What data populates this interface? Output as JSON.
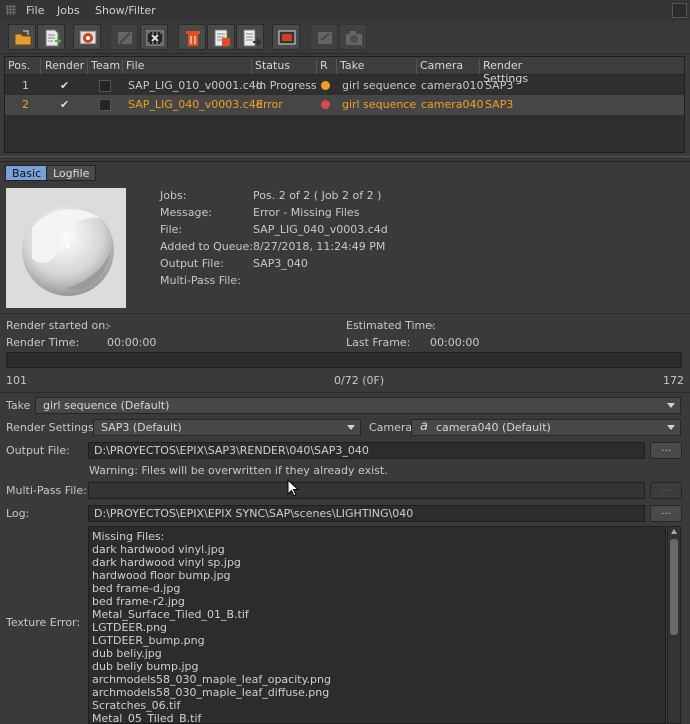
{
  "menu": {
    "file": "File",
    "jobs": "Jobs",
    "show_filter": "Show/Filter"
  },
  "table": {
    "headers": [
      "Pos.",
      "Render",
      "Team",
      "File",
      "Status",
      "R",
      "Take",
      "Camera",
      "Render Settings"
    ],
    "rows": [
      {
        "pos": "1",
        "file": "SAP_LIG_010_v0001.c4d",
        "status": "In Progress",
        "status_color": "#f0a020",
        "take": "girl sequence",
        "camera": "camera010",
        "render_settings": "SAP3"
      },
      {
        "pos": "2",
        "file": "SAP_LIG_040_v0003.c4d",
        "status": "Error",
        "status_color": "#e04848",
        "take": "girl sequence",
        "camera": "camera040",
        "render_settings": "SAP3"
      }
    ]
  },
  "tabs": {
    "basic": "Basic",
    "logfile": "Logfile"
  },
  "info": {
    "jobs_label": "Jobs:",
    "jobs_value": "Pos. 2 of 2 ( Job 2 of 2 )",
    "message_label": "Message:",
    "message_value": "Error - Missing Files",
    "file_label": "File:",
    "file_value": "SAP_LIG_040_v0003.c4d",
    "added_label": "Added to Queue:",
    "added_value": "8/27/2018, 11:24:49 PM",
    "output_label": "Output File:",
    "output_value": "SAP3_040",
    "multipass_label": "Multi-Pass File:"
  },
  "render": {
    "started_label": "Render started on:",
    "started_value": "-",
    "estimated_label": "Estimated Time:",
    "estimated_value": "-",
    "time_label": "Render Time:",
    "time_value": "00:00:00",
    "last_frame_label": "Last Frame:",
    "last_frame_value": "00:00:00",
    "progress_fraction": 0,
    "frame_start": "101",
    "frame_progress": "0/72 (0F)",
    "frame_end": "172"
  },
  "settings": {
    "take_label": "Take",
    "take_value": "girl sequence (Default)",
    "render_settings_label": "Render Settings",
    "render_settings_value": "SAP3 (Default)",
    "camera_label": "Camera",
    "camera_value": "camera040 (Default)",
    "output_label": "Output File:",
    "output_value": "D:\\PROYECTOS\\EPIX\\SAP3\\RENDER\\040\\SAP3_040",
    "warning": "Warning: Files will be overwritten if they already exist.",
    "multipass_label": "Multi-Pass File:",
    "multipass_value": "",
    "log_label": "Log:",
    "log_value": "D:\\PROYECTOS\\EPIX\\EPIX SYNC\\SAP\\scenes\\LIGHTING\\040",
    "browse_label": "...",
    "texture_error_label": "Texture Error:"
  },
  "texture_errors": [
    "Missing Files:",
    "dark hardwood vinyl.jpg",
    "dark hardwood vinyl sp.jpg",
    "hardwood floor bump.jpg",
    "bed frame-d.jpg",
    "bed frame-r2.jpg",
    "Metal_Surface_Tiled_01_B.tif",
    "LGTDEER.png",
    "LGTDEER_bump.png",
    "dub beliy.jpg",
    "dub beliy bump.jpg",
    "archmodels58_030_maple_leaf_opacity.png",
    "archmodels58_030_maple_leaf_diffuse.png",
    "Scratches_06.tif",
    "Metal_05_Tiled_B.tif"
  ]
}
